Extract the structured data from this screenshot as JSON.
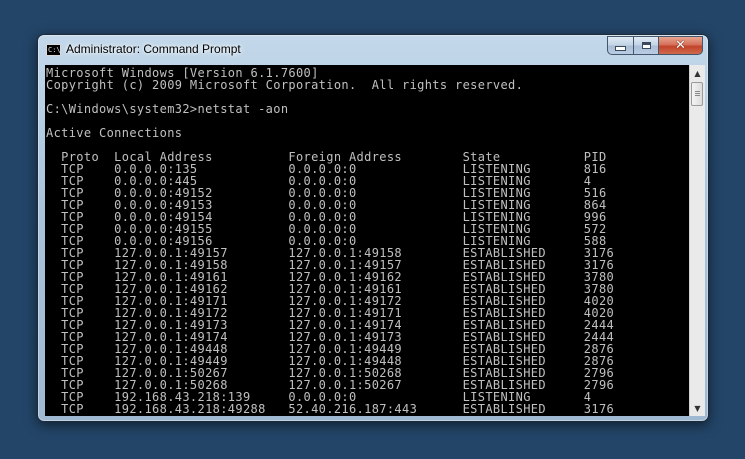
{
  "window": {
    "title": "Administrator: Command Prompt",
    "app_icon_glyph": "C:\\",
    "icons": {
      "app": "command-prompt-icon",
      "minimize": "minimize-icon",
      "maximize": "maximize-icon",
      "close": "close-icon"
    },
    "close_glyph": "✕"
  },
  "console": {
    "lines": [
      "Microsoft Windows [Version 6.1.7600]",
      "Copyright (c) 2009 Microsoft Corporation.  All rights reserved.",
      "",
      "C:\\Windows\\system32>netstat -aon",
      "",
      "Active Connections",
      "",
      "  Proto  Local Address          Foreign Address        State           PID",
      "  TCP    0.0.0.0:135            0.0.0.0:0              LISTENING       816",
      "  TCP    0.0.0.0:445            0.0.0.0:0              LISTENING       4",
      "  TCP    0.0.0.0:49152          0.0.0.0:0              LISTENING       516",
      "  TCP    0.0.0.0:49153          0.0.0.0:0              LISTENING       864",
      "  TCP    0.0.0.0:49154          0.0.0.0:0              LISTENING       996",
      "  TCP    0.0.0.0:49155          0.0.0.0:0              LISTENING       572",
      "  TCP    0.0.0.0:49156          0.0.0.0:0              LISTENING       588",
      "  TCP    127.0.0.1:49157        127.0.0.1:49158        ESTABLISHED     3176",
      "  TCP    127.0.0.1:49158        127.0.0.1:49157        ESTABLISHED     3176",
      "  TCP    127.0.0.1:49161        127.0.0.1:49162        ESTABLISHED     3780",
      "  TCP    127.0.0.1:49162        127.0.0.1:49161        ESTABLISHED     3780",
      "  TCP    127.0.0.1:49171        127.0.0.1:49172        ESTABLISHED     4020",
      "  TCP    127.0.0.1:49172        127.0.0.1:49171        ESTABLISHED     4020",
      "  TCP    127.0.0.1:49173        127.0.0.1:49174        ESTABLISHED     2444",
      "  TCP    127.0.0.1:49174        127.0.0.1:49173        ESTABLISHED     2444",
      "  TCP    127.0.0.1:49448        127.0.0.1:49449        ESTABLISHED     2876",
      "  TCP    127.0.0.1:49449        127.0.0.1:49448        ESTABLISHED     2876",
      "  TCP    127.0.0.1:50267        127.0.0.1:50268        ESTABLISHED     2796",
      "  TCP    127.0.0.1:50268        127.0.0.1:50267        ESTABLISHED     2796",
      "  TCP    192.168.43.218:139     0.0.0.0:0              LISTENING       4",
      "  TCP    192.168.43.218:49288   52.40.216.187:443      ESTABLISHED     3176"
    ]
  },
  "scrollbar": {
    "up_glyph": "▲",
    "down_glyph": "▼",
    "position_fraction": 0.0
  },
  "colors": {
    "desktop": "#234568",
    "console_bg": "#000000",
    "console_text": "#c0c0c0",
    "close_button": "#c7492f"
  }
}
